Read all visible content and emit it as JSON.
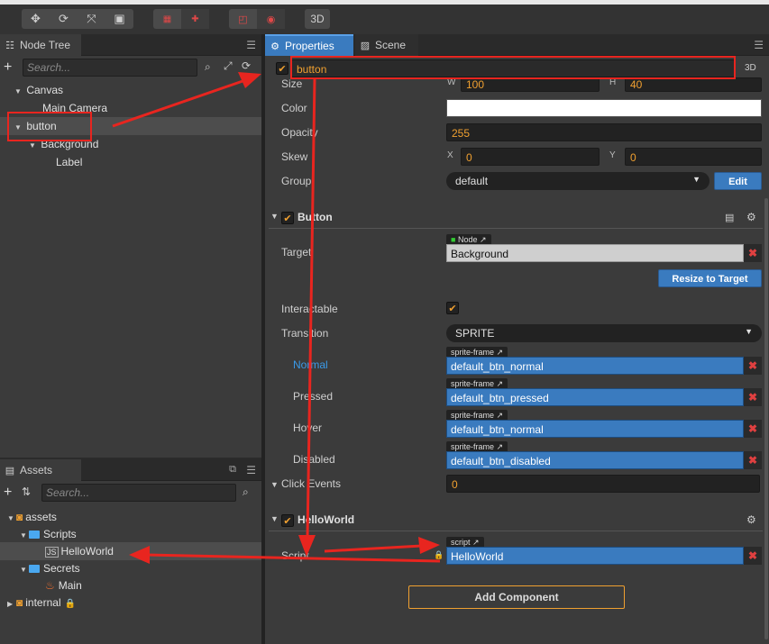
{
  "toolbar": {
    "mode_3d": "3D",
    "icons": [
      "move-icon",
      "rotate-icon",
      "scale-icon",
      "rect-icon",
      "anchor-icon",
      "pivot-icon",
      "local-icon",
      "global-icon"
    ]
  },
  "node_tree": {
    "tab": "Node Tree",
    "search_placeholder": "Search...",
    "items": [
      {
        "label": "Canvas"
      },
      {
        "label": "Main Camera"
      },
      {
        "label": "button"
      },
      {
        "label": "Background"
      },
      {
        "label": "Label"
      }
    ]
  },
  "assets": {
    "tab": "Assets",
    "search_placeholder": "Search...",
    "items": [
      {
        "label": "assets"
      },
      {
        "label": "Scripts"
      },
      {
        "label": "HelloWorld",
        "prefix": "JS"
      },
      {
        "label": "Secrets"
      },
      {
        "label": "Main"
      },
      {
        "label": "internal"
      }
    ]
  },
  "properties": {
    "tab": "Properties",
    "scene_tab": "Scene",
    "node_name": "button",
    "mode": "3D",
    "size": {
      "label": "Size",
      "w_label": "W",
      "w": "100",
      "h_label": "H",
      "h": "40"
    },
    "color_label": "Color",
    "opacity": {
      "label": "Opacity",
      "value": "255"
    },
    "skew": {
      "label": "Skew",
      "x_label": "X",
      "x": "0",
      "y_label": "Y",
      "y": "0"
    },
    "group": {
      "label": "Group",
      "value": "default",
      "edit": "Edit"
    },
    "button_section": {
      "title": "Button",
      "target_label": "Target",
      "target_tag": "Node",
      "target_value": "Background",
      "resize": "Resize to Target",
      "interactable_label": "Interactable",
      "transition_label": "Transition",
      "transition_value": "SPRITE",
      "states": [
        {
          "label": "Normal",
          "tag": "sprite-frame",
          "value": "default_btn_normal"
        },
        {
          "label": "Pressed",
          "tag": "sprite-frame",
          "value": "default_btn_pressed"
        },
        {
          "label": "Hover",
          "tag": "sprite-frame",
          "value": "default_btn_normal"
        },
        {
          "label": "Disabled",
          "tag": "sprite-frame",
          "value": "default_btn_disabled"
        }
      ],
      "click_events_label": "Click Events",
      "click_events_value": "0"
    },
    "hello_section": {
      "title": "HelloWorld",
      "script_label": "Script",
      "script_tag": "script",
      "script_value": "HelloWorld"
    },
    "add_component": "Add Component"
  },
  "colors": {
    "accent_orange": "#f0a030",
    "accent_blue": "#3a7bbf",
    "annotation_red": "#e8251f"
  }
}
